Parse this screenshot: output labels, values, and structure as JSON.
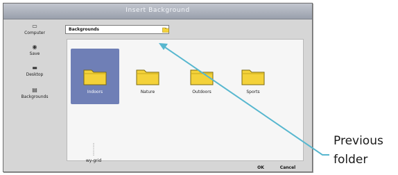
{
  "dialog": {
    "title": "Insert Background"
  },
  "sidebar": {
    "items": [
      {
        "label": "Computer",
        "icon": "computer-icon"
      },
      {
        "label": "Save",
        "icon": "save-icon"
      },
      {
        "label": "Desktop",
        "icon": "desktop-icon"
      },
      {
        "label": "Backgrounds",
        "icon": "backgrounds-icon"
      }
    ]
  },
  "location": {
    "current": "Backgrounds"
  },
  "files": [
    {
      "label": "Indoors",
      "selected": true
    },
    {
      "label": "Nature",
      "selected": false
    },
    {
      "label": "Outdoors",
      "selected": false
    },
    {
      "label": "Sports",
      "selected": false
    },
    {
      "label": "wy-grid",
      "selected": false
    }
  ],
  "buttons": {
    "ok": "OK",
    "cancel": "Cancel"
  },
  "callout": {
    "line1": "Previous",
    "line2": "folder"
  },
  "colors": {
    "accent": "#6f7fb6",
    "arrow": "#57b7cf",
    "folder": "#f4d23a"
  }
}
